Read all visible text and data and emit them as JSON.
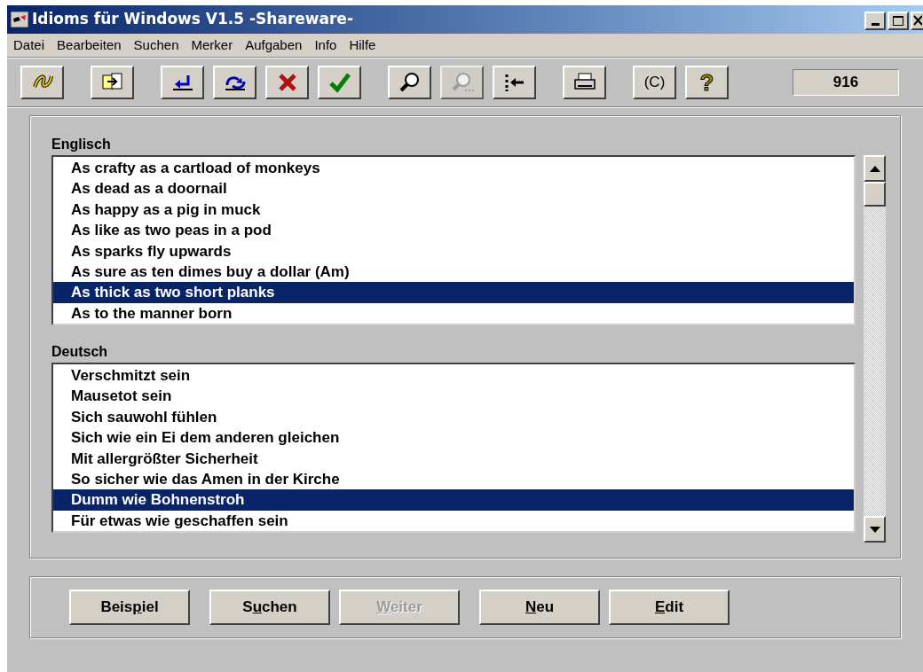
{
  "window": {
    "title": "Idioms für Windows V1.5 -Shareware-"
  },
  "menu": [
    "Datei",
    "Bearbeiten",
    "Suchen",
    "Merker",
    "Aufgaben",
    "Info",
    "Hilfe"
  ],
  "toolbar": [
    {
      "kind": "knot",
      "disabled": false
    },
    {
      "kind": "copy",
      "disabled": false
    },
    {
      "kind": "back",
      "disabled": false
    },
    {
      "kind": "swap",
      "disabled": false
    },
    {
      "kind": "delete",
      "disabled": false
    },
    {
      "kind": "check",
      "disabled": false
    },
    {
      "kind": "search",
      "disabled": false
    },
    {
      "kind": "search-next",
      "disabled": true
    },
    {
      "kind": "jump",
      "disabled": false
    },
    {
      "kind": "print",
      "disabled": false
    },
    {
      "kind": "text",
      "label": "(C)",
      "disabled": false
    },
    {
      "kind": "help",
      "label": "?",
      "disabled": false
    }
  ],
  "counter": "916",
  "lists": [
    {
      "label": "Englisch",
      "items": [
        {
          "text": "As crafty as a cartload of monkeys",
          "selected": false
        },
        {
          "text": "As dead as a doornail",
          "selected": false
        },
        {
          "text": "As happy as a pig in muck",
          "selected": false
        },
        {
          "text": "As like as two peas in a pod",
          "selected": false
        },
        {
          "text": "As sparks fly upwards",
          "selected": false
        },
        {
          "text": "As sure as ten dimes buy a dollar (Am)",
          "selected": false
        },
        {
          "text": "As thick as two short planks",
          "selected": true
        },
        {
          "text": "As to the manner born",
          "selected": false
        }
      ]
    },
    {
      "label": "Deutsch",
      "items": [
        {
          "text": "Verschmitzt sein",
          "selected": false
        },
        {
          "text": "Mausetot sein",
          "selected": false
        },
        {
          "text": "Sich sauwohl fühlen",
          "selected": false
        },
        {
          "text": "Sich wie ein Ei dem anderen gleichen",
          "selected": false
        },
        {
          "text": "Mit allergrößter Sicherheit",
          "selected": false
        },
        {
          "text": "So sicher wie das Amen in der Kirche",
          "selected": false
        },
        {
          "text": "Dumm wie Bohnenstroh",
          "selected": true
        },
        {
          "text": "Für etwas wie geschaffen sein",
          "selected": false
        }
      ]
    }
  ],
  "buttons": [
    {
      "before": "Beis",
      "key": "p",
      "after": "iel",
      "disabled": false
    },
    {
      "before": "S",
      "key": "u",
      "after": "chen",
      "disabled": false
    },
    {
      "key": "W",
      "after": "eiter",
      "disabled": true
    },
    {
      "key": "N",
      "after": "eu",
      "disabled": false
    },
    {
      "key": "E",
      "after": "dit",
      "disabled": false
    }
  ]
}
